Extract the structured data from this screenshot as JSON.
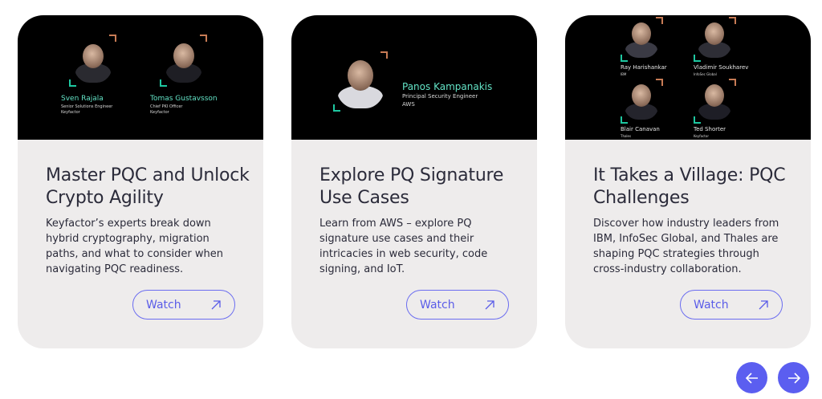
{
  "cards": [
    {
      "title": "Master PQC and Unlock Crypto Agility",
      "description": "Keyfactor’s experts break down hybrid cryptography, migration paths, and what to consider when navigating PQC readiness.",
      "cta": "Watch",
      "speakers": [
        {
          "name": "Sven Rajala",
          "role": "Senior Solutions Engineer",
          "org": "Keyfactor"
        },
        {
          "name": "Tomas Gustavsson",
          "role": "Chief PKI Officer",
          "org": "Keyfactor"
        }
      ]
    },
    {
      "title": "Explore PQ Signature Use Cases",
      "description": "Learn from AWS – explore PQ signature use cases and their intricacies in web security, code signing, and IoT.",
      "cta": "Watch",
      "speakers": [
        {
          "name": "Panos Kampanakis",
          "role": "Principal Security Engineer",
          "org": "AWS"
        }
      ]
    },
    {
      "title": "It Takes a Village: PQC Challenges",
      "description": "Discover how industry leaders from IBM, InfoSec Global, and Thales are shaping PQC strategies through cross-industry collaboration.",
      "cta": "Watch",
      "speakers": [
        {
          "name": "Ray Harishankar",
          "org": "IBM"
        },
        {
          "name": "Vladimir Soukharev",
          "org": "InfoSec Global"
        },
        {
          "name": "Blair Canavan",
          "org": "Thales"
        },
        {
          "name": "Ted Shorter",
          "org": "Keyfactor"
        }
      ]
    }
  ],
  "navigation": {
    "prev_icon": "arrow-left-icon",
    "next_icon": "arrow-right-icon"
  },
  "colors": {
    "accent": "#5b5ef0",
    "card_bg": "#eeecec",
    "name_color": "#63e3c6",
    "corner_orange": "#c77b55",
    "corner_green": "#1ec7a0"
  }
}
